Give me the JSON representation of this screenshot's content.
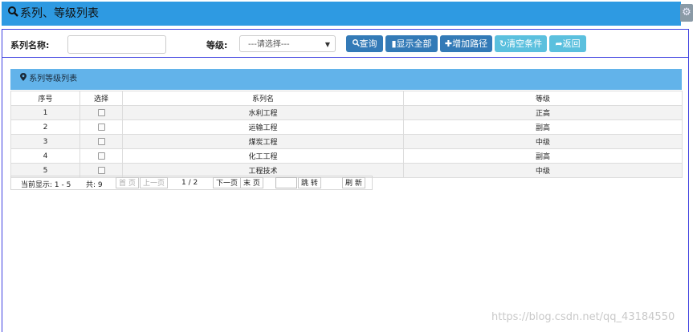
{
  "header": {
    "title": "系列、等级列表",
    "icon": "search-icon",
    "settings_icon": "gear-icon"
  },
  "search": {
    "name_label": "系列名称:",
    "name_value": "",
    "grade_label": "等级:",
    "grade_selected": "---请选择---",
    "buttons": {
      "query": "查询",
      "show_all": "显示全部",
      "add_path": "增加路径",
      "clear": "清空条件",
      "back": "返回"
    }
  },
  "panel": {
    "title": "系列等级列表",
    "icon": "map-marker-icon"
  },
  "table": {
    "columns": [
      "序号",
      "选择",
      "系列名",
      "等级"
    ],
    "rows": [
      {
        "no": "1",
        "name": "水利工程",
        "grade": "正高"
      },
      {
        "no": "2",
        "name": "运输工程",
        "grade": "副高"
      },
      {
        "no": "3",
        "name": "煤炭工程",
        "grade": "中级"
      },
      {
        "no": "4",
        "name": "化工工程",
        "grade": "副高"
      },
      {
        "no": "5",
        "name": "工程技术",
        "grade": "中级"
      }
    ]
  },
  "pager": {
    "current_display": "当前显示: 1 - 5",
    "total": "共: 9",
    "first": "首 页",
    "prev": "上一页",
    "page": "1 / 2",
    "next": "下一页",
    "last": "末 页",
    "jump": "跳 转",
    "refresh": "刷 新"
  },
  "watermark": "https://blog.csdn.net/qq_43184550",
  "colors": {
    "header": "#2e9ae2",
    "panel_head": "#62b3ea",
    "btn_dark": "#337ab7",
    "btn_light": "#5bc0de",
    "frame_border": "#3d3fe0"
  }
}
